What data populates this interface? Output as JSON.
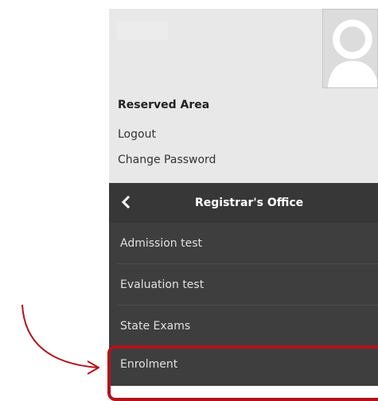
{
  "profile": {
    "section_title": "Reserved Area",
    "logout_label": "Logout",
    "change_password_label": "Change Password",
    "avatar_icon": "user-avatar-icon"
  },
  "menu": {
    "back_icon": "chevron-left-icon",
    "title": "Registrar's Office",
    "items": [
      {
        "label": "Admission test"
      },
      {
        "label": "Evaluation test"
      },
      {
        "label": "State Exams"
      },
      {
        "label": "Enrolment"
      }
    ]
  },
  "annotation": {
    "arrow_icon": "curved-arrow-icon",
    "highlight_color": "#b3121b"
  }
}
